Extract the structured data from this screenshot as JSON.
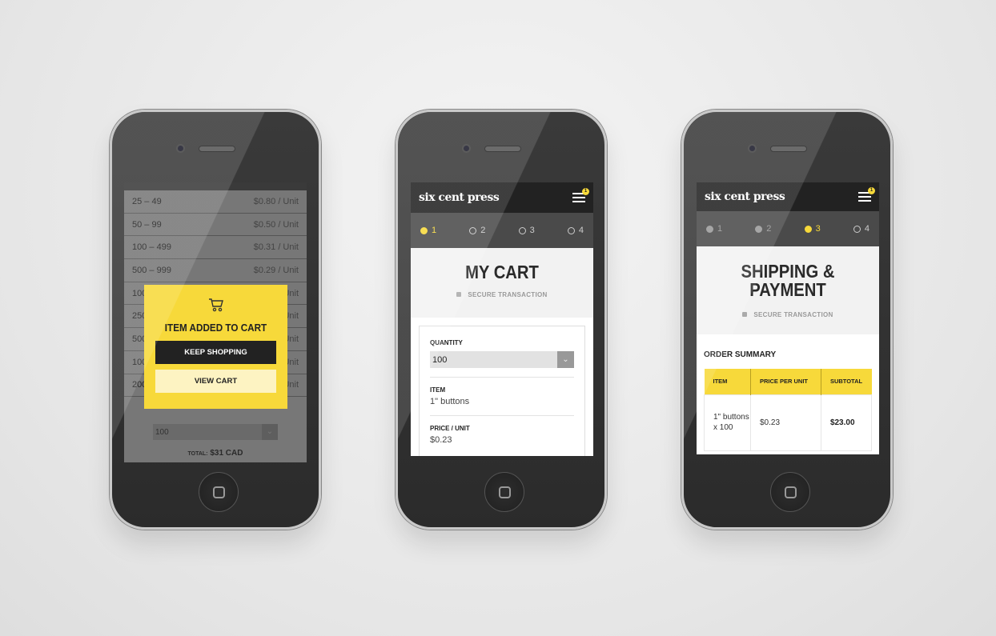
{
  "brand": {
    "logo": "six cent press",
    "accent": "#f7d93a",
    "menu_badge": "1"
  },
  "phone1": {
    "pricing_rows": [
      {
        "range": "25 – 49",
        "price": "$0.80 / Unit"
      },
      {
        "range": "50 – 99",
        "price": "$0.50 / Unit"
      },
      {
        "range": "100 – 499",
        "price": "$0.31 / Unit"
      },
      {
        "range": "500 – 999",
        "price": "$0.29 / Unit"
      },
      {
        "range": "100",
        "price": "Unit"
      },
      {
        "range": "250",
        "price": "Unit"
      },
      {
        "range": "500",
        "price": "Unit"
      },
      {
        "range": "100",
        "price": "Unit"
      },
      {
        "range": "200",
        "price": "Unit"
      }
    ],
    "quantity_value": "100",
    "total_label": "TOTAL:",
    "total_value": "$31 CAD",
    "modal": {
      "icon": "cart-icon",
      "title": "ITEM ADDED TO CART",
      "keep_shopping": "KEEP SHOPPING",
      "view_cart": "VIEW CART"
    }
  },
  "phone2": {
    "steps": [
      "1",
      "2",
      "3",
      "4"
    ],
    "active_step": 1,
    "title": "MY CART",
    "secure": "SECURE TRANSACTION",
    "quantity_label": "QUANTITY",
    "quantity_value": "100",
    "item_label": "ITEM",
    "item_value": "1\" buttons",
    "price_label": "PRICE / UNIT",
    "price_value": "$0.23"
  },
  "phone3": {
    "steps": [
      "1",
      "2",
      "3",
      "4"
    ],
    "active_step": 3,
    "title_line1": "SHIPPING &",
    "title_line2": "PAYMENT",
    "secure": "SECURE TRANSACTION",
    "order_summary": "ORDER SUMMARY",
    "columns": [
      "ITEM",
      "PRICE PER UNIT",
      "SUBTOTAL"
    ],
    "row": {
      "item": "1\" buttons x 100",
      "price": "$0.23",
      "subtotal": "$23.00"
    }
  }
}
